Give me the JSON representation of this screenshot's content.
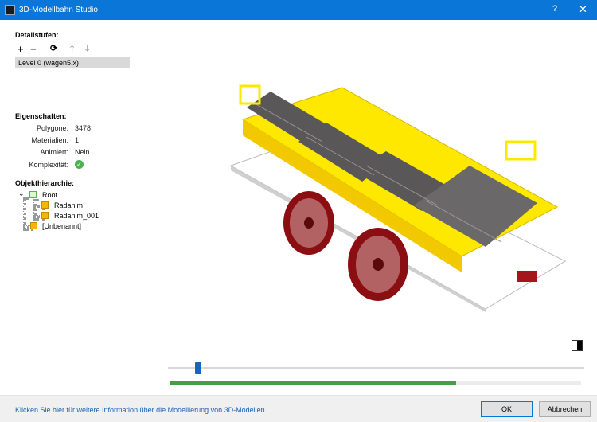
{
  "window": {
    "title": "3D-Modellbahn Studio",
    "help": "?",
    "close": "✕"
  },
  "detail": {
    "heading": "Detailstufen:",
    "toolbar": {
      "add": "+",
      "remove": "−",
      "refresh": "⟳",
      "up": "🡑",
      "down": "🡓"
    },
    "levels": [
      "Level 0 (wagen5.x)"
    ]
  },
  "properties": {
    "heading": "Eigenschaften:",
    "rows": [
      {
        "label": "Polygone:",
        "value": "3478"
      },
      {
        "label": "Materialien:",
        "value": "1"
      },
      {
        "label": "Animiert:",
        "value": "Nein"
      },
      {
        "label": "Komplexität:",
        "value": "✓"
      }
    ]
  },
  "hierarchy": {
    "heading": "Objekthierarchie:",
    "root": "Root",
    "children": [
      "Radanim",
      "Radanim_001"
    ],
    "sibling": "[Unbenannt]"
  },
  "slider": {
    "position": 0.065
  },
  "progress": {
    "fraction": 0.695
  },
  "footer": {
    "link": "Klicken Sie hier für weitere Information über die Modellierung von 3D-Modellen",
    "ok": "OK",
    "cancel": "Abbrechen"
  },
  "colors": {
    "accent": "#0a76d8",
    "frame": "#ffe800",
    "wheel": "#8b0f12",
    "seat": "#595757"
  }
}
